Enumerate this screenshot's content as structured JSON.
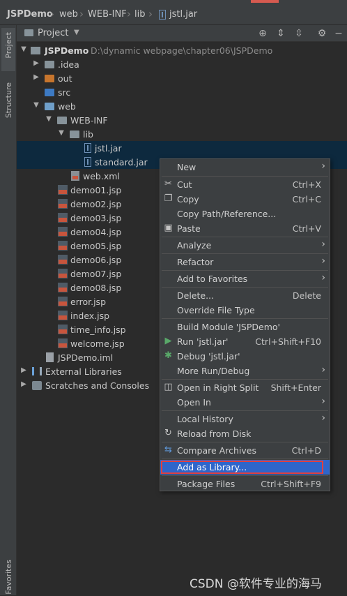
{
  "breadcrumb": {
    "items": [
      "JSPDemo",
      "web",
      "WEB-INF",
      "lib",
      "jstl.jar"
    ]
  },
  "tool_strip": {
    "project_tab": "Project",
    "structure_tab": "Structure",
    "favorites_tab": "Favorites"
  },
  "project_panel": {
    "title": "Project",
    "header_icons": [
      "locate-icon",
      "expand-all-icon",
      "collapse-all-icon",
      "gear-icon",
      "hide-icon"
    ]
  },
  "tree": {
    "root_name": "JSPDemo",
    "root_path": "D:\\dynamic webpage\\chapter06\\JSPDemo",
    "idea": ".idea",
    "out": "out",
    "src": "src",
    "web": "web",
    "webinf": "WEB-INF",
    "lib": "lib",
    "jstl": "jstl.jar",
    "standard": "standard.jar",
    "webxml": "web.xml",
    "jsp_files": [
      "demo01.jsp",
      "demo02.jsp",
      "demo03.jsp",
      "demo04.jsp",
      "demo05.jsp",
      "demo06.jsp",
      "demo07.jsp",
      "demo08.jsp",
      "error.jsp",
      "index.jsp",
      "time_info.jsp",
      "welcome.jsp"
    ],
    "iml": "JSPDemo.iml",
    "external_libraries": "External Libraries",
    "scratches": "Scratches and Consoles"
  },
  "context_menu": {
    "new": "New",
    "cut": "Cut",
    "cut_sc": "Ctrl+X",
    "copy": "Copy",
    "copy_sc": "Ctrl+C",
    "copy_path": "Copy Path/Reference...",
    "paste": "Paste",
    "paste_sc": "Ctrl+V",
    "analyze": "Analyze",
    "refactor": "Refactor",
    "add_favorites": "Add to Favorites",
    "delete": "Delete...",
    "delete_sc": "Delete",
    "override": "Override File Type",
    "build": "Build Module 'JSPDemo'",
    "run": "Run 'jstl.jar'",
    "run_sc": "Ctrl+Shift+F10",
    "debug": "Debug 'jstl.jar'",
    "more_run": "More Run/Debug",
    "open_split": "Open in Right Split",
    "open_split_sc": "Shift+Enter",
    "open_in": "Open In",
    "local_history": "Local History",
    "reload": "Reload from Disk",
    "compare": "Compare Archives",
    "compare_sc": "Ctrl+D",
    "add_library": "Add as Library...",
    "package": "Package Files",
    "package_sc": "Ctrl+Shift+F9"
  },
  "watermark": "CSDN @软件专业的海马",
  "colors": {
    "background": "#2b2b2b",
    "panel": "#3c3f41",
    "selection": "#0d293e",
    "menu_highlight": "#2f65ca",
    "annotation_box": "#e04040"
  }
}
